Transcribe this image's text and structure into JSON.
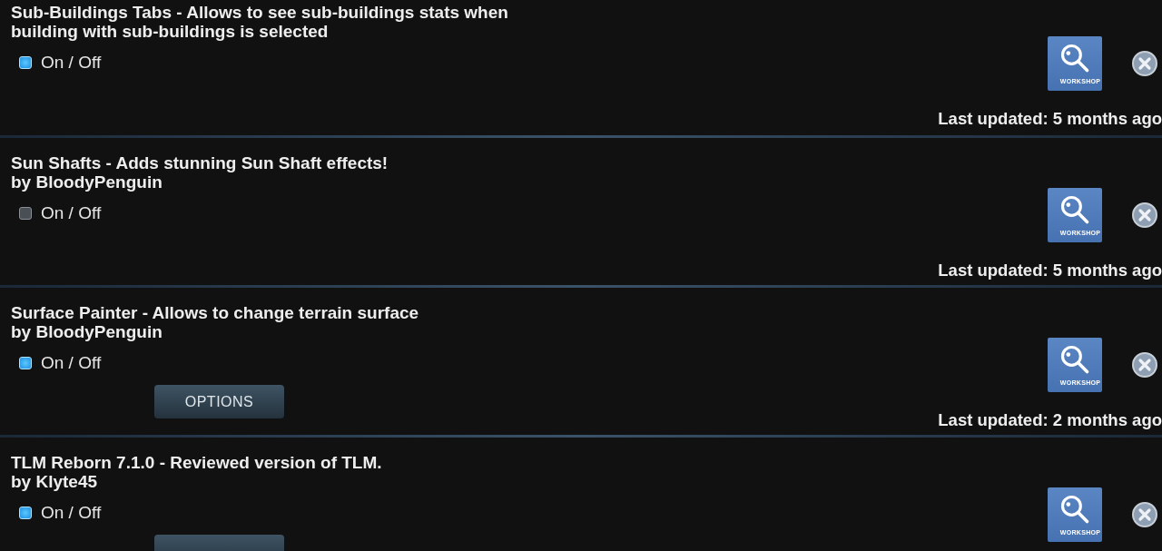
{
  "mods": [
    {
      "title": "Sub-Buildings Tabs - Allows to see sub-buildings stats when building with sub-buildings is selected",
      "toggle": {
        "label": "On / Off",
        "checked": true
      },
      "workshop_label": "WORKSHOP",
      "last_updated": "Last updated: 5 months ago"
    },
    {
      "title": "Sun Shafts - Adds stunning Sun Shaft effects!",
      "author": "by BloodyPenguin",
      "toggle": {
        "label": "On / Off",
        "checked": false
      },
      "workshop_label": "WORKSHOP",
      "last_updated": "Last updated: 5 months ago"
    },
    {
      "title": "Surface Painter - Allows to change terrain surface",
      "author": "by BloodyPenguin",
      "toggle": {
        "label": "On / Off",
        "checked": true
      },
      "options": "OPTIONS",
      "workshop_label": "WORKSHOP",
      "last_updated": "Last updated: 2 months ago"
    },
    {
      "title": "TLM Reborn 7.1.0 - Reviewed version of TLM.",
      "author": "by Klyte45",
      "toggle": {
        "label": "On / Off",
        "checked": true
      },
      "has_options": true,
      "workshop_label": "WORKSHOP"
    }
  ]
}
